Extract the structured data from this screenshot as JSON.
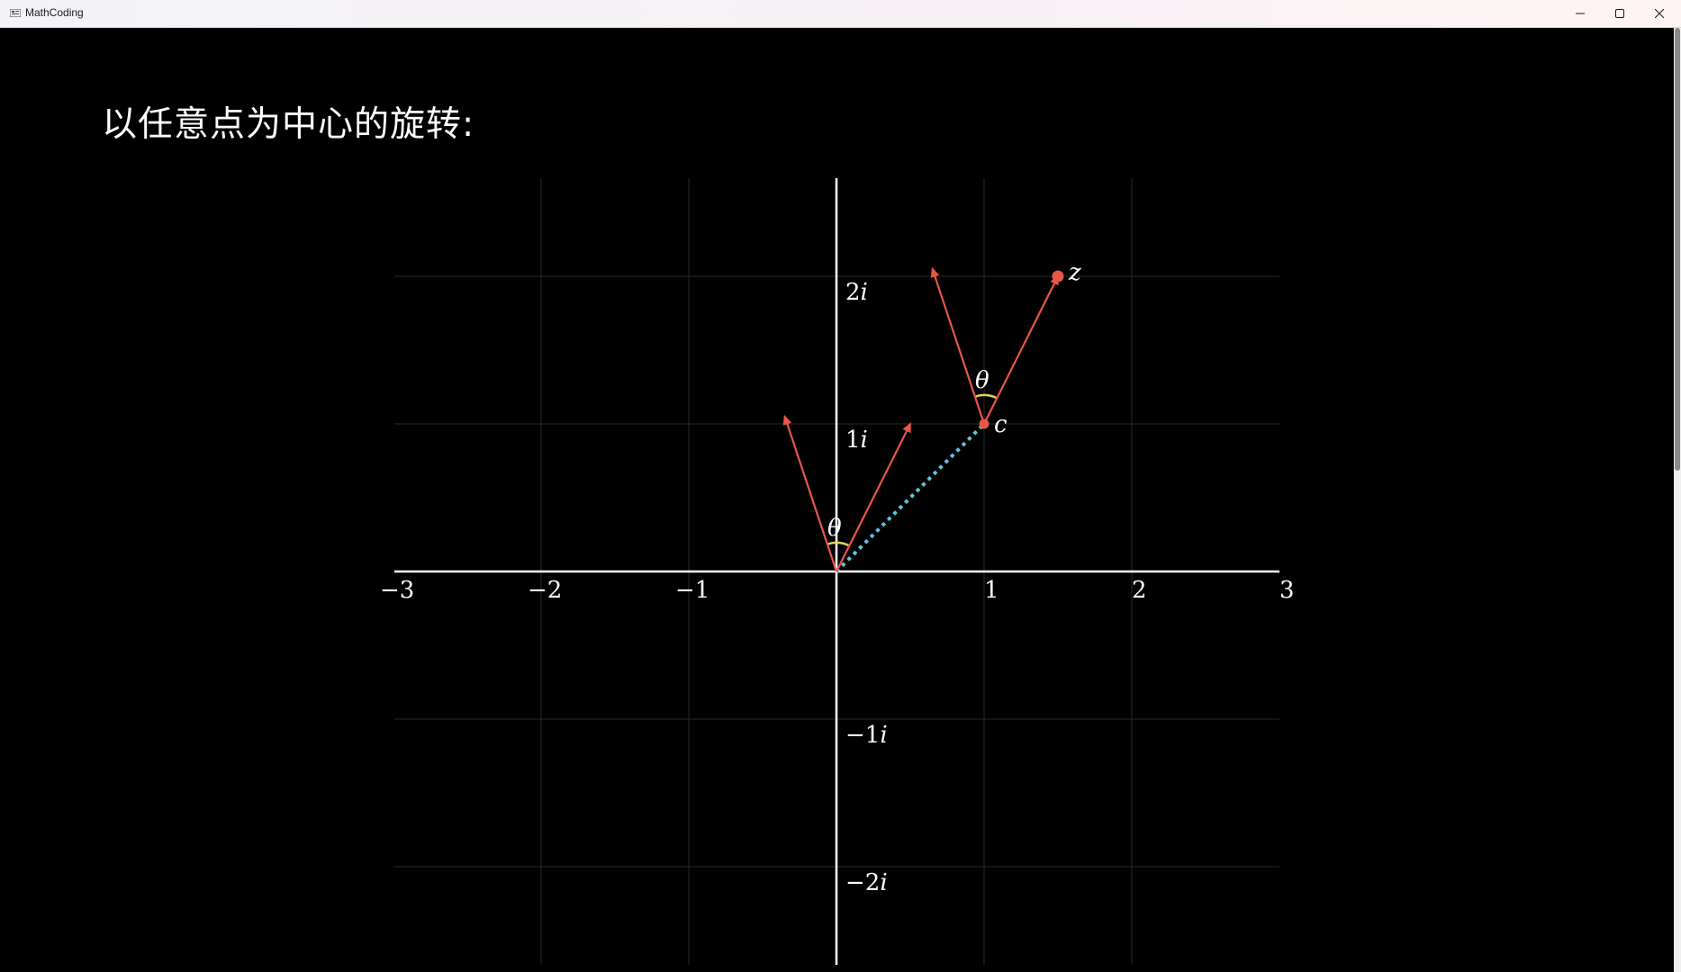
{
  "window": {
    "title": "MathCoding"
  },
  "heading": "以任意点为中心的旋转:",
  "colors": {
    "vector": "#e8564a",
    "angle": "#e8d25a",
    "dotted": "#5fc3e4",
    "axis": "#ffffff",
    "grid": "#2a2a2a"
  },
  "plane": {
    "x_range": [
      -3,
      3
    ],
    "y_range": [
      -2.7,
      2.7
    ],
    "x_ticks": [
      {
        "value": -3,
        "label": "−3"
      },
      {
        "value": -2,
        "label": "−2"
      },
      {
        "value": -1,
        "label": "−1"
      },
      {
        "value": 1,
        "label": "1"
      },
      {
        "value": 2,
        "label": "2"
      },
      {
        "value": 3,
        "label": "3"
      }
    ],
    "y_ticks": [
      {
        "value": 2,
        "num": "2",
        "unit": "i"
      },
      {
        "value": 1,
        "num": "1",
        "unit": "i"
      },
      {
        "value": -1,
        "num": "−1",
        "unit": "i"
      },
      {
        "value": -2,
        "num": "−2",
        "unit": "i"
      }
    ],
    "points": {
      "c": {
        "x": 1,
        "y": 1,
        "label": "c"
      },
      "z": {
        "x": 1.5,
        "y": 2,
        "label": "z"
      }
    },
    "theta_label": "θ",
    "vectors_at_origin": [
      {
        "name": "vector-origin",
        "dx": 0.5,
        "dy": 1
      },
      {
        "name": "vector-origin-rotated",
        "dx": -0.35,
        "dy": 1.05
      }
    ],
    "vectors_at_c": [
      {
        "name": "vector-c-to-z",
        "dx": 0.5,
        "dy": 1
      },
      {
        "name": "vector-c-rotated",
        "dx": -0.35,
        "dy": 1.05
      }
    ]
  }
}
